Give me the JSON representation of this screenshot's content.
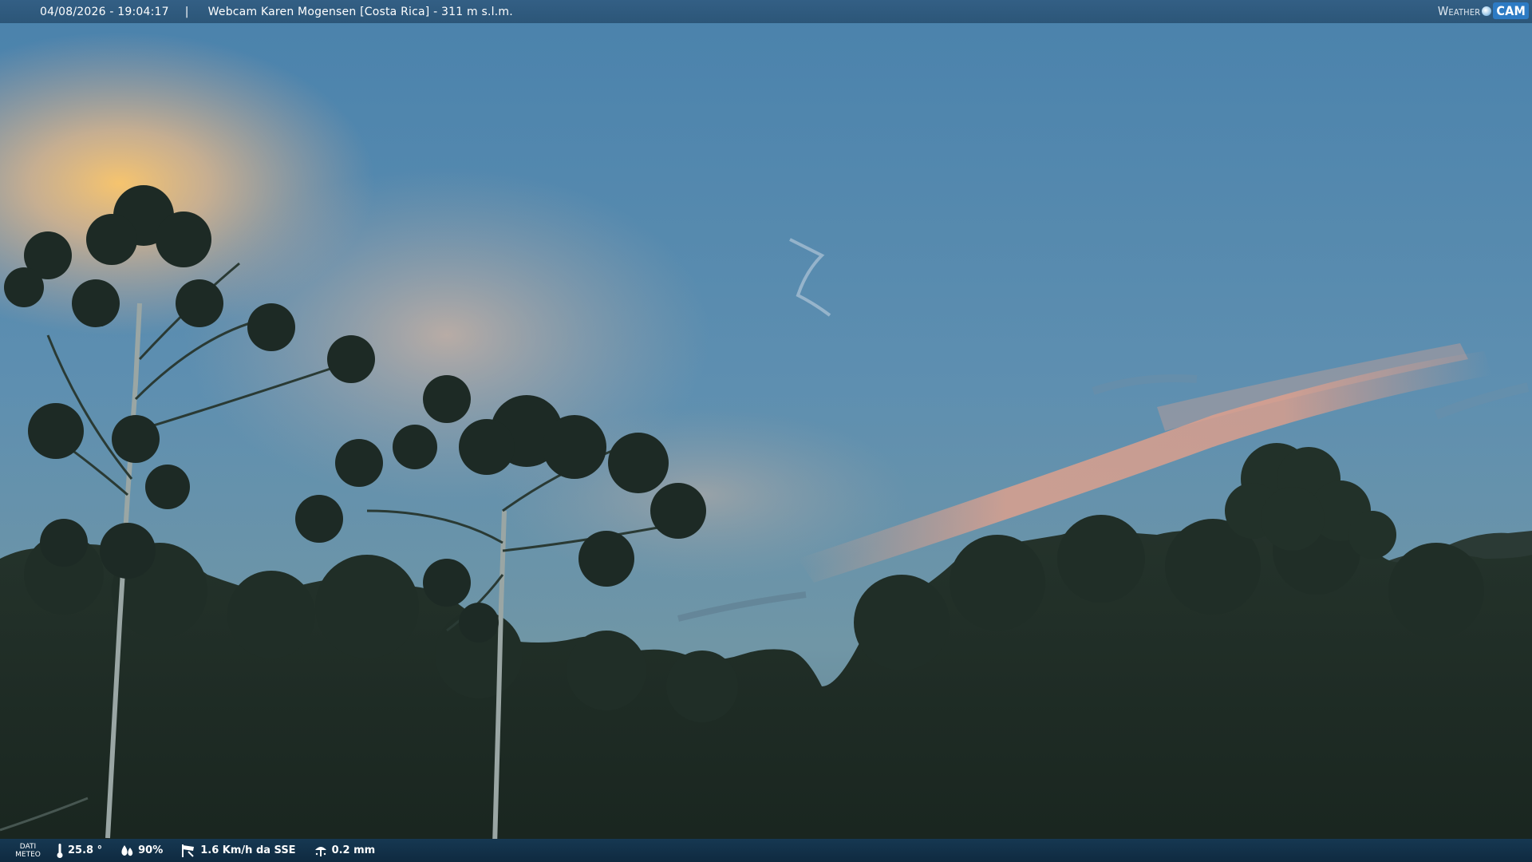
{
  "header": {
    "datetime": "04/08/2026 - 19:04:17",
    "separator": "|",
    "title": "Webcam Karen Mogensen [Costa Rica]  - 311 m s.l.m."
  },
  "logo": {
    "weather": "Weather",
    "cam": "CAM"
  },
  "weather_bar": {
    "label_line1": "DATI",
    "label_line2": "METEO",
    "temperature": "25.8 °",
    "humidity": "90%",
    "wind": "1.6 Km/h da SSE",
    "rain": "0.2 mm"
  },
  "icons": {
    "temperature": "thermometer-icon",
    "humidity": "humidity-drop-icon",
    "wind": "wind-sock-icon",
    "rain": "rain-gauge-icon",
    "logo": "weathercam-logo-icon"
  },
  "colors": {
    "top_bar": "#2f5a7f",
    "bottom_bar": "#12314a",
    "sky_top": "#4d84ad",
    "sky_bottom": "#6e94a8",
    "glow": "#f1c27a",
    "pink_cloud": "#d9a08a",
    "forest": "#1d2b25"
  }
}
